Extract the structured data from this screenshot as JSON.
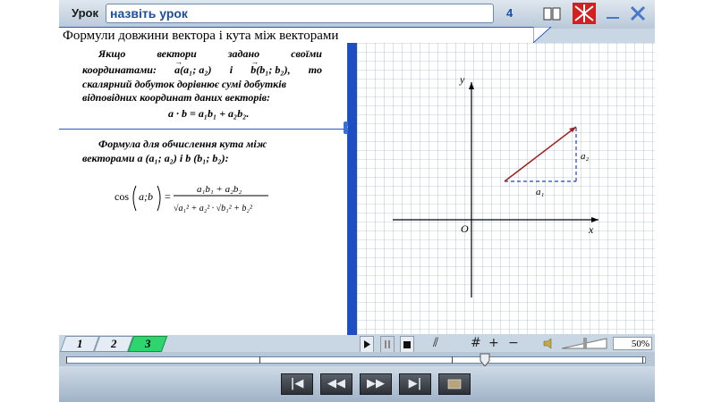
{
  "header": {
    "lesson_label": "Урок",
    "lesson_value": "назвіть урок",
    "page_number": "4"
  },
  "title": "Формули довжини вектора і кута між векторами",
  "panel1": {
    "line1_words": [
      "Якщо",
      "вектори",
      "задано",
      "своїми"
    ],
    "line2a": "координатами:",
    "vec_a": "a",
    "coords_a": "(a₁; a₂)",
    "conj": "і",
    "vec_b": "b",
    "coords_b": "(b₁; b₂),",
    "then": "то",
    "line3": "скалярний добуток дорівнює сумі добутків",
    "line4": "відповідних координат даних векторів:",
    "formula": "a · b = a₁b₁ + a₂b₂."
  },
  "panel2": {
    "line1": "Формула для обчислення кута між",
    "line2_prefix": "векторами",
    "line2_a": "a",
    "line2_mid": "(a₁; a₂) і",
    "line2_b": "b",
    "line2_suffix": "(b₁; b₂):",
    "cos": "cos",
    "numerator": "a₁b₁ + a₂b₂"
  },
  "graph": {
    "y_label": "y",
    "x_label": "x",
    "origin_label": "O",
    "a1_label": "a₁",
    "a2_label": "a₂",
    "vector_color": "#a01e1e",
    "dashed_color": "#1e3fd6"
  },
  "tabs": [
    {
      "label": "1"
    },
    {
      "label": "2"
    },
    {
      "label": "3"
    }
  ],
  "controls": {
    "zoom": "50%"
  },
  "colors": {
    "accent_blue": "#1e4fc2",
    "active_tab": "#2ed46e"
  }
}
